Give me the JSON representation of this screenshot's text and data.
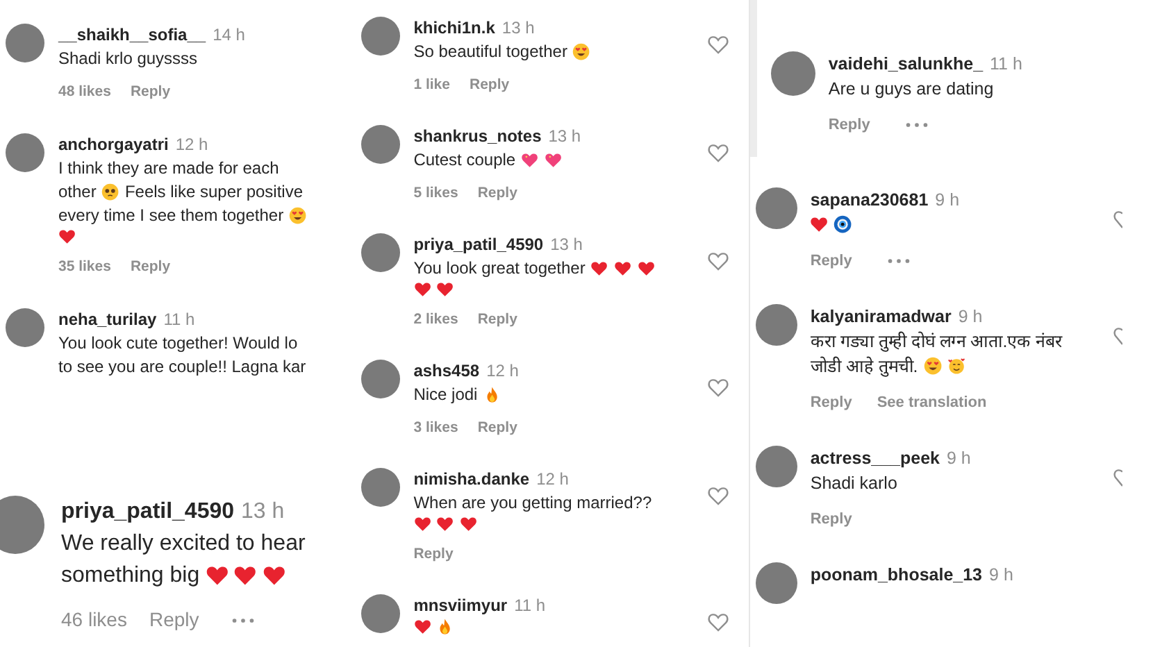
{
  "columns": [
    {
      "panels": [
        {
          "kind": "small",
          "comments": [
            {
              "username": "__shaikh__sofia__",
              "time": "14 h",
              "lines": [
                [
                  {
                    "kind": "text",
                    "text": "Shadi krlo guyssss"
                  }
                ]
              ],
              "likes": "48 likes",
              "reply": "Reply",
              "more": false
            },
            {
              "username": "anchorgayatri",
              "time": "12 h",
              "lines": [
                [
                  {
                    "kind": "text",
                    "text": "I think they are made for each"
                  }
                ],
                [
                  {
                    "kind": "text",
                    "text": "other"
                  },
                  {
                    "kind": "pleading"
                  },
                  {
                    "kind": "text",
                    "text": "Feels like super positive"
                  }
                ],
                [
                  {
                    "kind": "text",
                    "text": "every time I see them together"
                  },
                  {
                    "kind": "heart_eyes"
                  }
                ],
                [
                  {
                    "kind": "heart"
                  }
                ]
              ],
              "likes": "35 likes",
              "reply": "Reply",
              "more": false
            },
            {
              "username": "neha_turilay",
              "time": "11 h",
              "lines": [
                [
                  {
                    "kind": "text",
                    "text": "You look cute together! Would lo"
                  }
                ],
                [
                  {
                    "kind": "text",
                    "text": "to see you are couple!! Lagna kar"
                  }
                ]
              ]
            }
          ]
        },
        {
          "kind": "large",
          "comments": [
            {
              "username": "priya_patil_4590",
              "time": "13 h",
              "lines": [
                [
                  {
                    "kind": "text",
                    "text": "We really excited to hear"
                  }
                ],
                [
                  {
                    "kind": "text",
                    "text": "something big"
                  },
                  {
                    "kind": "heart"
                  },
                  {
                    "kind": "heart"
                  },
                  {
                    "kind": "heart"
                  }
                ]
              ],
              "likes": "46 likes",
              "reply": "Reply",
              "more": true
            }
          ]
        }
      ]
    },
    {
      "panels": [
        {
          "kind": "small",
          "comments": [
            {
              "username": "khichi1n.k",
              "time": "13 h",
              "lines": [
                [
                  {
                    "kind": "text",
                    "text": "So beautiful together"
                  },
                  {
                    "kind": "heart_eyes"
                  }
                ]
              ],
              "likes": "1 like",
              "reply": "Reply",
              "more": false,
              "like_button": {
                "kind": "full"
              }
            },
            {
              "username": "shankrus_notes",
              "time": "13 h",
              "lines": [
                [
                  {
                    "kind": "text",
                    "text": "Cutest couple"
                  },
                  {
                    "kind": "sparkling_heart"
                  },
                  {
                    "kind": "sparkling_heart"
                  }
                ]
              ],
              "likes": "5 likes",
              "reply": "Reply",
              "more": false,
              "like_button": {
                "kind": "full"
              }
            },
            {
              "username": "priya_patil_4590",
              "time": "13 h",
              "lines": [
                [
                  {
                    "kind": "text",
                    "text": "You look great together"
                  },
                  {
                    "kind": "heart"
                  },
                  {
                    "kind": "heart"
                  },
                  {
                    "kind": "heart"
                  }
                ],
                [
                  {
                    "kind": "heart"
                  },
                  {
                    "kind": "heart"
                  }
                ]
              ],
              "likes": "2 likes",
              "reply": "Reply",
              "more": false,
              "like_button": {
                "kind": "full"
              }
            },
            {
              "username": "ashs458",
              "time": "12 h",
              "lines": [
                [
                  {
                    "kind": "text",
                    "text": "Nice jodi"
                  },
                  {
                    "kind": "fire"
                  }
                ]
              ],
              "likes": "3 likes",
              "reply": "Reply",
              "more": false,
              "like_button": {
                "kind": "full"
              }
            }
          ]
        },
        {
          "kind": "small",
          "comments": [
            {
              "username": "nimisha.danke",
              "time": "12 h",
              "lines": [
                [
                  {
                    "kind": "text",
                    "text": "When are you getting married??"
                  }
                ],
                [
                  {
                    "kind": "heart"
                  },
                  {
                    "kind": "heart"
                  },
                  {
                    "kind": "heart"
                  }
                ]
              ],
              "reply": "Reply",
              "more": false,
              "like_button": {
                "kind": "full"
              }
            },
            {
              "username": "mnsviimyur",
              "time": "11 h",
              "lines": [
                [
                  {
                    "kind": "heart"
                  },
                  {
                    "kind": "fire"
                  }
                ]
              ],
              "like_button": {
                "kind": "full"
              }
            }
          ]
        }
      ]
    },
    {
      "panels": [
        {
          "kind": "medium",
          "comments": [
            {
              "username": "vaidehi_salunkhe_",
              "time": "11 h",
              "lines": [
                [
                  {
                    "kind": "text",
                    "text": "Are u guys are dating"
                  }
                ]
              ],
              "reply": "Reply",
              "more": true,
              "thread": true
            },
            {
              "username": "sapana230681",
              "time": "9 h",
              "lines": [
                [
                  {
                    "kind": "heart"
                  },
                  {
                    "kind": "nazar"
                  }
                ]
              ],
              "reply": "Reply",
              "more": true,
              "like_button": {
                "kind": "clipped"
              }
            },
            {
              "username": "kalyaniramadwar",
              "time": "9 h",
              "lines": [
                [
                  {
                    "kind": "text",
                    "text": "करा गड्या तुम्ही दोघं लग्न आता.एक नंबर"
                  }
                ],
                [
                  {
                    "kind": "text",
                    "text": "जोडी आहे तुमची."
                  },
                  {
                    "kind": "heart_eyes"
                  },
                  {
                    "kind": "hug_hearts"
                  }
                ]
              ],
              "reply": "Reply",
              "translation": "See translation",
              "more": false,
              "like_button": {
                "kind": "clipped"
              }
            },
            {
              "username": "actress___peek",
              "time": "9 h",
              "lines": [
                [
                  {
                    "kind": "text",
                    "text": "Shadi karlo"
                  }
                ]
              ],
              "reply": "Reply",
              "more": false,
              "like_button": {
                "kind": "clipped"
              }
            },
            {
              "username": "poonam_bhosale_13",
              "time": "9 h"
            }
          ]
        }
      ]
    }
  ]
}
